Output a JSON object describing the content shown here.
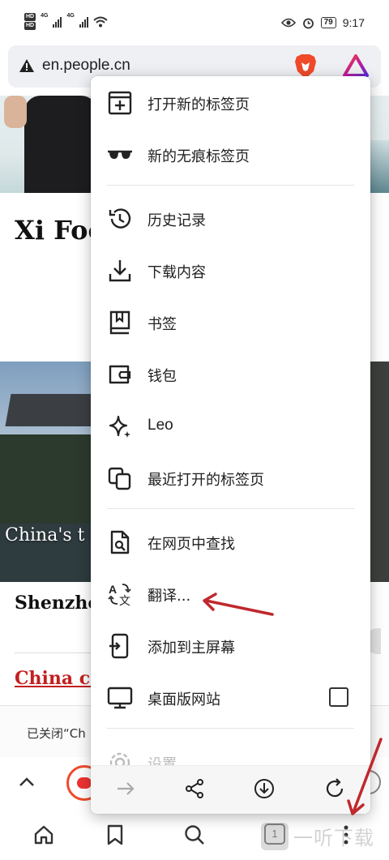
{
  "status_bar": {
    "hd_badges": [
      "HD",
      "HD"
    ],
    "network": [
      "4G",
      "4G"
    ],
    "battery": "79",
    "time": "9:17"
  },
  "url_bar": {
    "url": "en.people.cn",
    "icons": [
      "warning-icon",
      "brave-lion-icon",
      "brave-rewards-icon"
    ]
  },
  "page": {
    "headline": "Xi Foo backk manu innov",
    "photo_caption": "China's t summer",
    "story2": "Shenzho extrave",
    "story3": "China ca Chinese"
  },
  "menu": {
    "items": [
      {
        "label": "打开新的标签页",
        "icon": "new-tab-icon"
      },
      {
        "label": "新的无痕标签页",
        "icon": "incognito-glasses-icon"
      },
      {
        "label": "历史记录",
        "icon": "history-icon"
      },
      {
        "label": "下载内容",
        "icon": "download-icon"
      },
      {
        "label": "书签",
        "icon": "bookmark-icon"
      },
      {
        "label": "钱包",
        "icon": "wallet-icon"
      },
      {
        "label": "Leo",
        "icon": "leo-sparkle-icon"
      },
      {
        "label": "最近打开的标签页",
        "icon": "recent-tabs-icon"
      },
      {
        "label": "在网页中查找",
        "icon": "find-in-page-icon"
      },
      {
        "label": "翻译...",
        "icon": "translate-icon"
      },
      {
        "label": "添加到主屏幕",
        "icon": "add-to-home-icon"
      },
      {
        "label": "桌面版网站",
        "icon": "desktop-icon",
        "checked": false
      },
      {
        "label": "设置",
        "icon": "settings-gear-icon"
      }
    ],
    "actions": [
      "forward-arrow-icon",
      "share-icon",
      "download-circle-icon",
      "reload-icon"
    ]
  },
  "snackbar": {
    "text": "已关闭“Ch"
  },
  "bottom_nav": {
    "tab_count": "1",
    "items": [
      "home-icon",
      "bookmark-icon",
      "search-icon",
      "tab-switcher-icon",
      "more-menu-icon"
    ]
  },
  "watermark": {
    "text": "一听下载"
  },
  "colors": {
    "annotation": "#c0282d",
    "brave": "#f04a2a",
    "link": "#c41f1f"
  }
}
